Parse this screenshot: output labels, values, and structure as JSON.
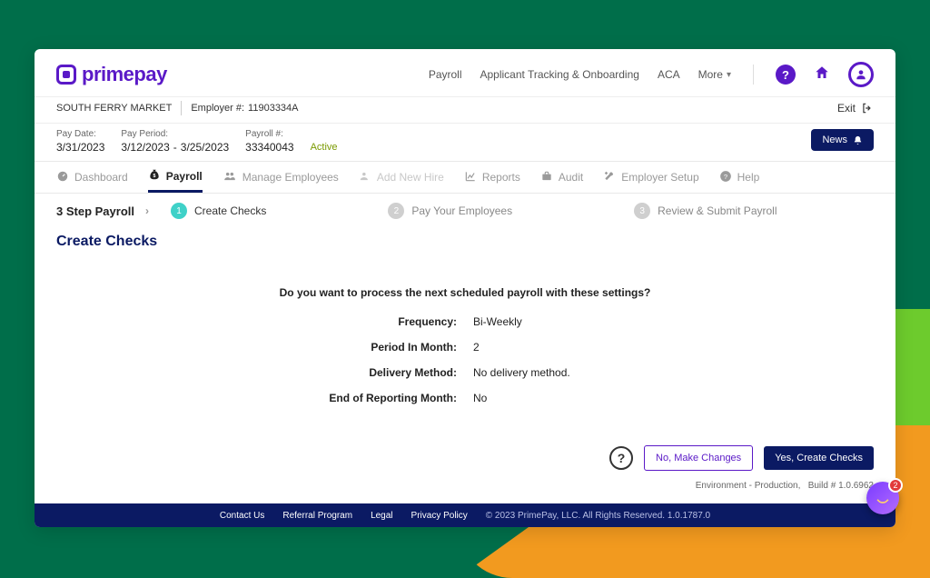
{
  "brand": {
    "name": "primepay"
  },
  "topnav": {
    "items": [
      "Payroll",
      "Applicant Tracking & Onboarding",
      "ACA"
    ],
    "more_label": "More"
  },
  "company": {
    "name": "SOUTH FERRY MARKET",
    "employer_label": "Employer #:",
    "employer_number": "11903334A"
  },
  "exit_label": "Exit",
  "info": {
    "pay_date_label": "Pay Date:",
    "pay_date": "3/31/2023",
    "pay_period_label": "Pay Period:",
    "pay_period_start": "3/12/2023",
    "pay_period_sep": "-",
    "pay_period_end": "3/25/2023",
    "payroll_num_label": "Payroll #:",
    "payroll_num": "33340043",
    "status": "Active"
  },
  "news_label": "News",
  "tabs": {
    "dashboard": "Dashboard",
    "payroll": "Payroll",
    "manage_employees": "Manage Employees",
    "add_new_hire": "Add New Hire",
    "reports": "Reports",
    "audit": "Audit",
    "employer_setup": "Employer Setup",
    "help": "Help"
  },
  "steps": {
    "title": "3 Step Payroll",
    "s1": "Create Checks",
    "s2": "Pay Your Employees",
    "s3": "Review & Submit Payroll"
  },
  "page_title": "Create Checks",
  "prompt": "Do you want to process the next scheduled payroll with these settings?",
  "settings": {
    "frequency_label": "Frequency:",
    "frequency": "Bi-Weekly",
    "period_label": "Period In Month:",
    "period": "2",
    "delivery_label": "Delivery Method:",
    "delivery": "No delivery method.",
    "eorm_label": "End of Reporting Month:",
    "eorm": "No"
  },
  "actions": {
    "no": "No, Make Changes",
    "yes": "Yes, Create Checks"
  },
  "env": {
    "text": "Environment - Production,",
    "build_label": "Build #",
    "build": "1.0.6962"
  },
  "footer": {
    "contact": "Contact Us",
    "referral": "Referral Program",
    "legal": "Legal",
    "privacy": "Privacy Policy",
    "copyright": "© 2023 PrimePay, LLC. All Rights Reserved.   1.0.1787.0"
  },
  "chat": {
    "badge": "2"
  }
}
